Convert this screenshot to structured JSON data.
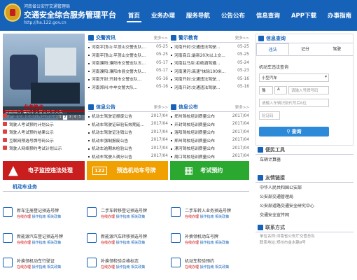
{
  "header": {
    "small_text": "河南省公安厅交通管理局",
    "title": "交通安全综合服务管理平台",
    "url": "http://ha.122.gov.cn",
    "nav": [
      "首页",
      "业务办理",
      "服务导航",
      "公告公布",
      "信息查询",
      "APP下载",
      "办事指南"
    ]
  },
  "photo": {
    "caption": "河南周口:濮阳市交警支队五大队...",
    "pages": [
      "1",
      "2",
      "3",
      "4",
      "5"
    ]
  },
  "news": {
    "title": "交警资讯",
    "more": "更多>>",
    "items": [
      {
        "text": "河南平顶山:平顶山交警支队...",
        "date": "05-25"
      },
      {
        "text": "河南平顶山:平顶山交警支队...",
        "date": "05-25"
      },
      {
        "text": "河南濮阳:濮阳市交警支队五...",
        "date": "05-17"
      },
      {
        "text": "河南濮阳:濮阳市县交警大队...",
        "date": "05-17"
      },
      {
        "text": "河南开封:开封市交警支队...",
        "date": "05-16"
      },
      {
        "text": "河南郑州:中牟交警大队...",
        "date": "05-16"
      }
    ]
  },
  "warning": {
    "title": "警示教育",
    "more": "更多>>",
    "items": [
      {
        "text": "河南开封:交通违法驾驶...",
        "date": "05-25"
      },
      {
        "text": "河南商丘:最新20次以上交...",
        "date": "05-25"
      },
      {
        "text": "河南驻马店:拒绝酒驾遵...",
        "date": "05-24"
      },
      {
        "text": "河南漯河:高速\"抹除100米...",
        "date": "05-23"
      },
      {
        "text": "河南开封:交通违法驾驶...",
        "date": "05-16"
      },
      {
        "text": "河南开封:交通违法驾驶...",
        "date": "05-16"
      }
    ]
  },
  "hot": {
    "title": "业务热点",
    "items": [
      "严重交通违法行为公开公示",
      "驾驶人考试预约计划公示",
      "驾驶人考试预约结果公示",
      "互联网预选号牌号码公示",
      "驾驶人网络预约考试计划公示"
    ]
  },
  "notice": {
    "title": "信息公告",
    "more": "更多>>",
    "items": [
      {
        "text": "机动车驾驶证报废公告",
        "date": "2017/04"
      },
      {
        "text": "机动车驾驶证审验有效期延...",
        "date": "2017/04"
      },
      {
        "text": "机动车驾驶证注销公告",
        "date": "2017/04"
      },
      {
        "text": "机动车强制报废公告",
        "date": "2017/04"
      },
      {
        "text": "机动车逾期未检验公告",
        "date": "2017/04"
      },
      {
        "text": "机动车驾驶人满分公告",
        "date": "2017/04"
      }
    ]
  },
  "info": {
    "title": "信息公布",
    "more": "更多>>",
    "items": [
      {
        "text": "郑州驾校培训质量公布",
        "date": "2017/04"
      },
      {
        "text": "开封驾校培训质量公布",
        "date": "2017/04"
      },
      {
        "text": "洛阳驾校培训质量公布",
        "date": "2017/04"
      },
      {
        "text": "郑州驾校培训质量公布",
        "date": "2017/04"
      },
      {
        "text": "漯河驾校培训质量公布",
        "date": "2017/04"
      },
      {
        "text": "周口驾校培训质量公布",
        "date": "2017/04"
      }
    ]
  },
  "banners": [
    "电子监控违法处理",
    "预选机动车号牌",
    "考试预约"
  ],
  "banner_glyphs": [
    "122"
  ],
  "business": {
    "title": "机动车业务",
    "links": "在线办理",
    "links2": "操作指南",
    "links3": "相关政策",
    "items": [
      "新车注册登记预选号牌",
      "二手车转移登记预选号牌",
      "二手车转入业务预选号牌",
      "新能源汽车登记预选号牌",
      "新能源汽车转移预选号牌",
      "补换领机动车号牌",
      "补换领机动车行驶证",
      "补换领检验合格标志",
      "机动车检验预约"
    ]
  },
  "query": {
    "title": "信息查询",
    "tabs": [
      "违法",
      "记分",
      "驾驶"
    ],
    "subtitle": "机动车违法查询",
    "vehicle_type": "小型汽车",
    "plate_prefix": "豫",
    "plate_letter": "A",
    "plate_placeholder": "请输入号牌号码",
    "vin_placeholder": "请输入车辆识别代号后6位",
    "captcha_placeholder": "验证码",
    "button": "查询"
  },
  "tools": {
    "title": "便民工具",
    "items": [
      "车辆计算器"
    ]
  },
  "links": {
    "title": "友情链接",
    "items": [
      "中华人民共和国公安部",
      "公安部交通管理局",
      "公安部道路交通安全研究中心",
      "交通安全宣传网"
    ]
  },
  "contact": {
    "title": "联系方式",
    "lines": [
      "单位名称:河南省公安厅交管总队",
      "联系地址:郑州市金水路9号"
    ]
  }
}
